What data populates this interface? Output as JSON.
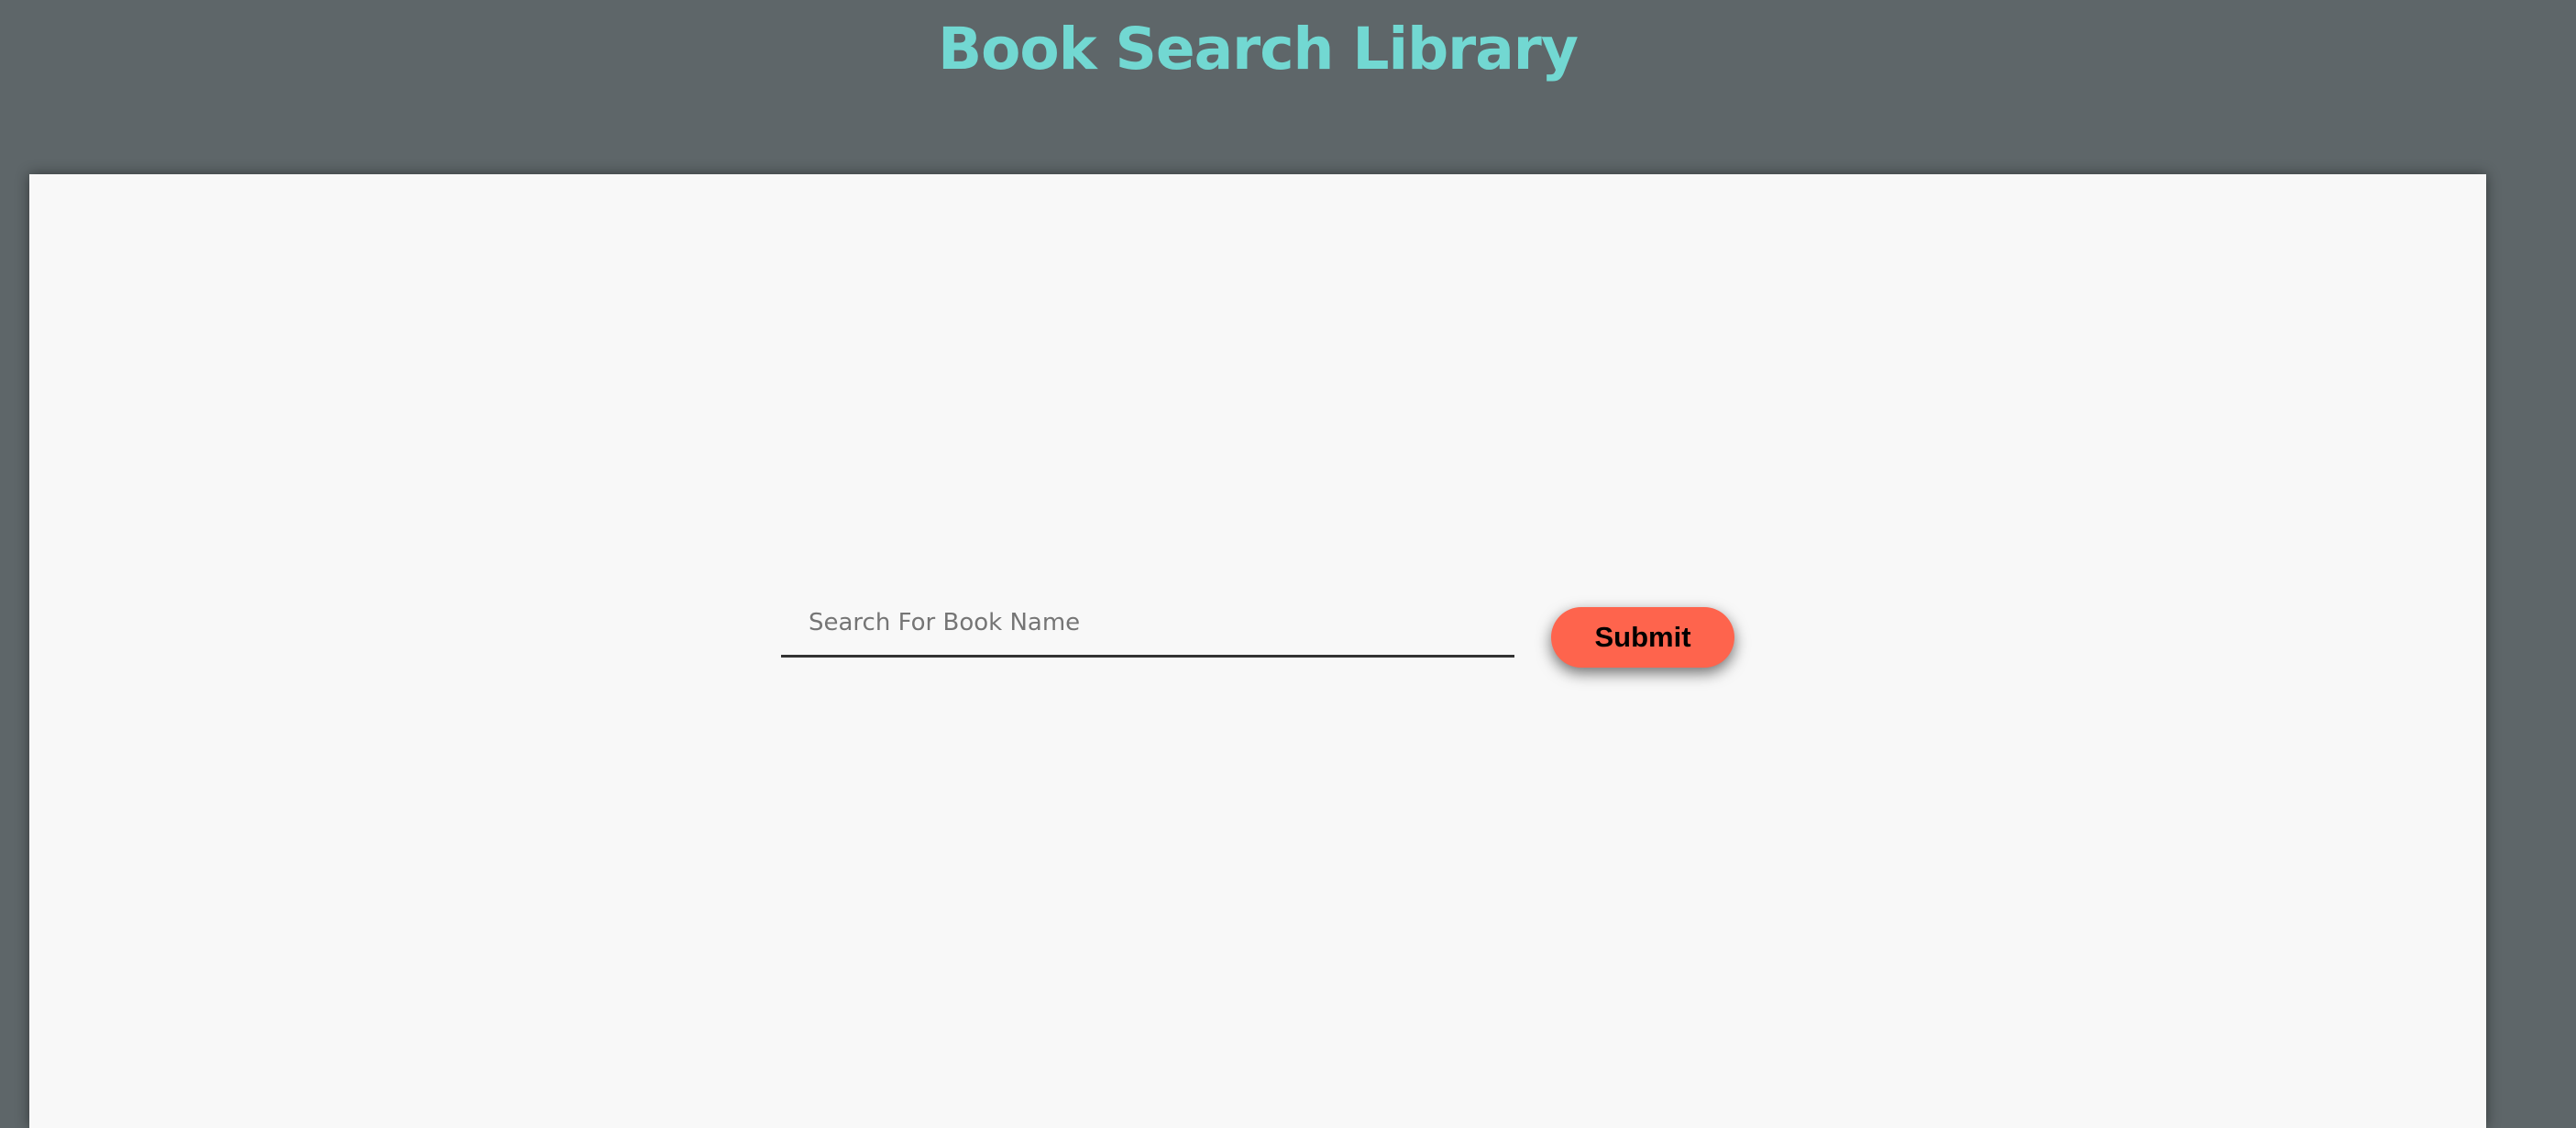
{
  "header": {
    "title": "Book Search Library"
  },
  "search": {
    "placeholder": "Search For Book Name",
    "value": "",
    "submit_label": "Submit"
  },
  "colors": {
    "background": "#5e6669",
    "title": "#72d8d2",
    "panel": "#f8f8f8",
    "submit_button": "#fe644d"
  }
}
